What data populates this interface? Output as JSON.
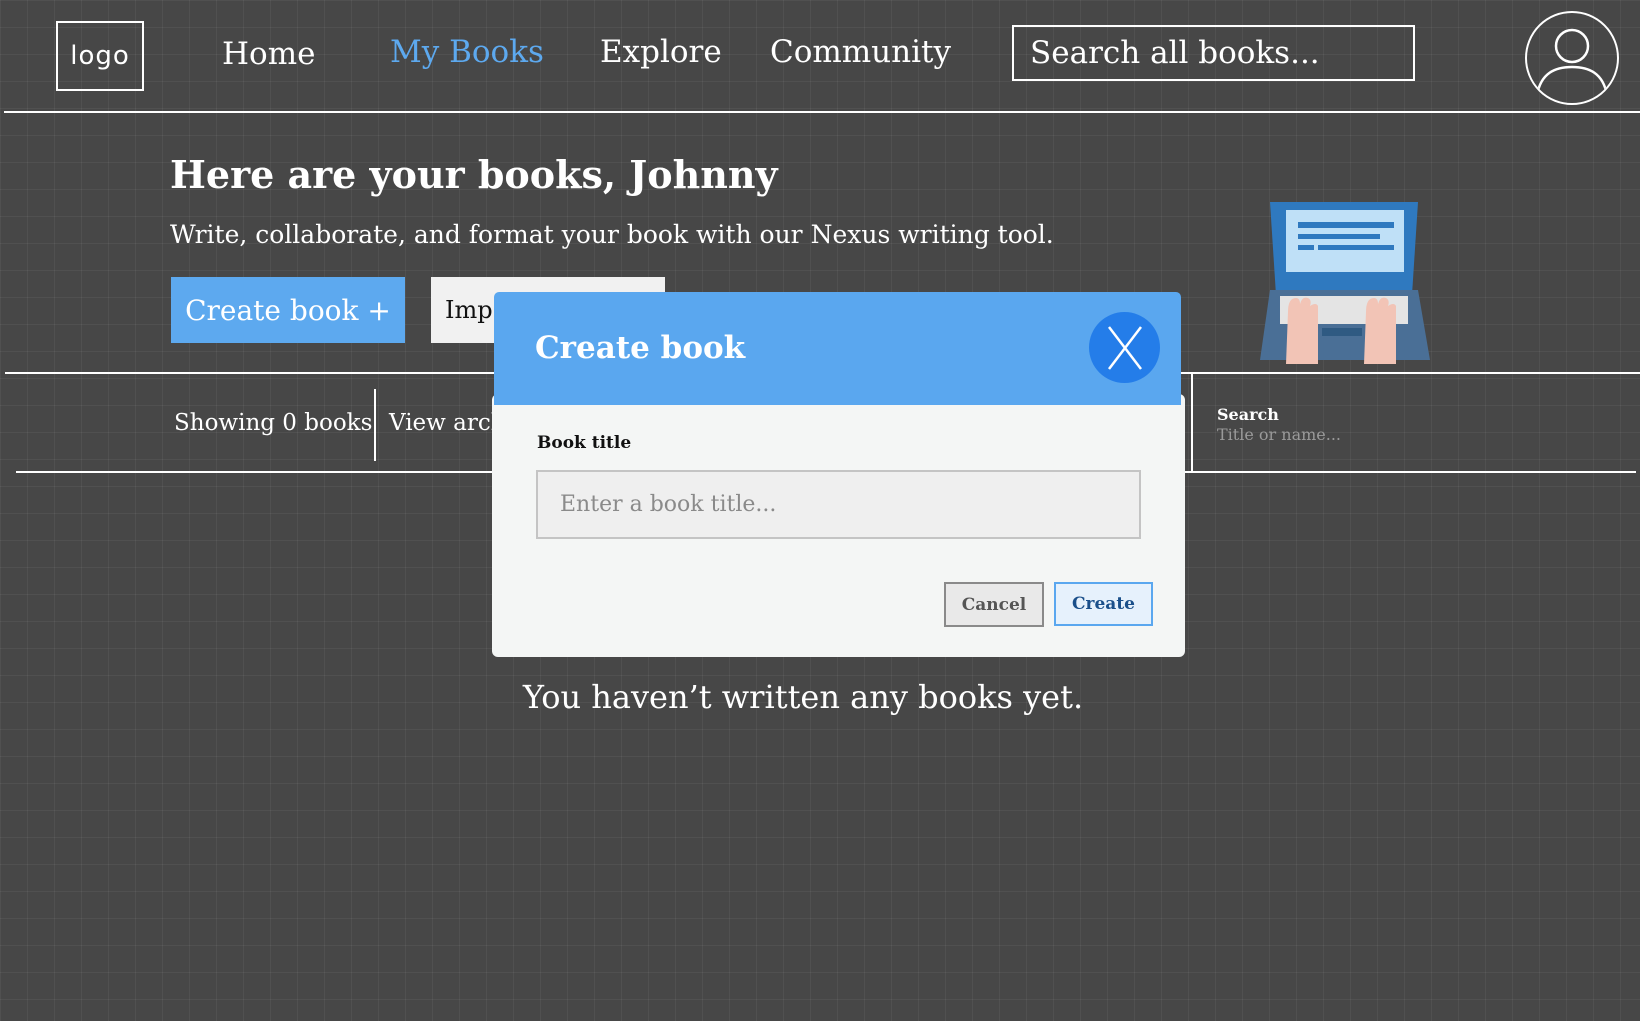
{
  "header": {
    "logo_text": "logo",
    "nav": [
      {
        "label": "Home",
        "active": false
      },
      {
        "label": "My Books",
        "active": true
      },
      {
        "label": "Explore",
        "active": false
      },
      {
        "label": "Community",
        "active": false
      }
    ],
    "search_text": "Search all books...",
    "avatar_icon": "user-icon"
  },
  "hero": {
    "title": "Here are your books, Johnny",
    "subtitle": "Write, collaborate, and format your book with our Nexus writing tool.",
    "create_button": "Create book +",
    "import_button": "Imp",
    "illustration": "laptop-typing-icon"
  },
  "filter_bar": {
    "count_text": "Showing 0 books",
    "archive_text": "View arch",
    "search_label": "Search",
    "search_placeholder": "Title or name..."
  },
  "empty_message": "You haven’t written any books yet.",
  "modal": {
    "title": "Create book",
    "close_label": "X",
    "field_label": "Book title",
    "input_placeholder": "Enter a book title...",
    "input_value": "",
    "cancel_label": "Cancel",
    "create_label": "Create"
  },
  "colors": {
    "accent": "#5da9ef",
    "modal_header": "#5aa7ef",
    "close_button": "#247de9",
    "background": "#474747"
  }
}
